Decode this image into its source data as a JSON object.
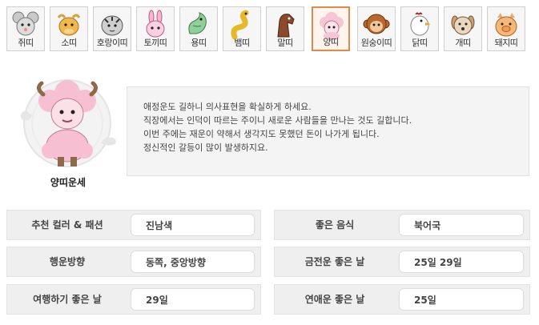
{
  "zodiac_tabs": [
    {
      "label": "쥐띠",
      "icon": "rat-icon",
      "active": false
    },
    {
      "label": "소띠",
      "icon": "ox-icon",
      "active": false
    },
    {
      "label": "호랑이띠",
      "icon": "tiger-icon",
      "active": false
    },
    {
      "label": "토끼띠",
      "icon": "rabbit-icon",
      "active": false
    },
    {
      "label": "용띠",
      "icon": "dragon-icon",
      "active": false
    },
    {
      "label": "뱀띠",
      "icon": "snake-icon",
      "active": false
    },
    {
      "label": "말띠",
      "icon": "horse-icon",
      "active": false
    },
    {
      "label": "양띠",
      "icon": "sheep-icon",
      "active": true
    },
    {
      "label": "원숭이띠",
      "icon": "monkey-icon",
      "active": false
    },
    {
      "label": "닭띠",
      "icon": "rooster-icon",
      "active": false
    },
    {
      "label": "개띠",
      "icon": "dog-icon",
      "active": false
    },
    {
      "label": "돼지띠",
      "icon": "pig-icon",
      "active": false
    }
  ],
  "hero": {
    "label": "양띠운세",
    "icon": "sheep-character-icon"
  },
  "fortune": {
    "lines": [
      "애정운도 길하니 의사표현을 확실하게 하세요.",
      "직장에서는 인덕이 따르는 주이니 새로운 사람들을 만나는 것도 길합니다.",
      "이번 주에는 재운이 약해서 생각지도 못했던 돈이 나가게 됩니다.",
      "정신적인 갈등이 많이 발생하지요."
    ]
  },
  "info": {
    "color_label": "추천 컬러 & 패션",
    "color_value": "진남색",
    "food_label": "좋은 음식",
    "food_value": "북어국",
    "direction_label": "행운방향",
    "direction_value": "동쪽, 중앙방향",
    "money_day_label": "금전운 좋은 날",
    "money_day_value": "25일 29일",
    "travel_day_label": "여행하기 좋은 날",
    "travel_day_value": "29일",
    "love_day_label": "연애운 좋은 날",
    "love_day_value": "25일"
  },
  "colors": {
    "active_border": "#e08a4a",
    "box_bg": "#f4f4f4",
    "row_bg": "#efefef"
  }
}
